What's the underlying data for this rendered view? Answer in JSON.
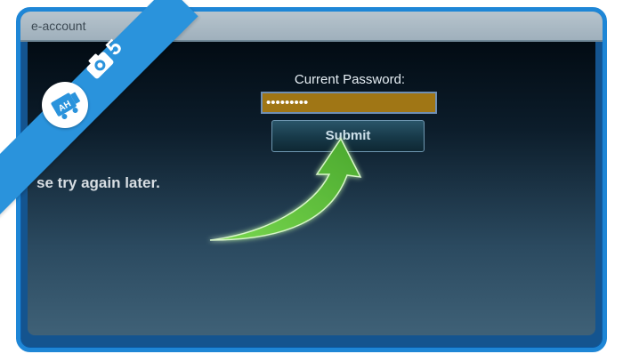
{
  "window": {
    "title": "e-account"
  },
  "form": {
    "password_label": "Current Password:",
    "password_value": "•••••••••",
    "submit_label": "Submit"
  },
  "message": "se try again later.",
  "ribbon": {
    "step": "5",
    "icon": "camera-icon",
    "logo": "ah-logo-icon"
  },
  "colors": {
    "frame": "#1e86d6",
    "input_fill": "#a07615",
    "arrow": "#5fbf3c",
    "ribbon": "#2a93dc"
  }
}
